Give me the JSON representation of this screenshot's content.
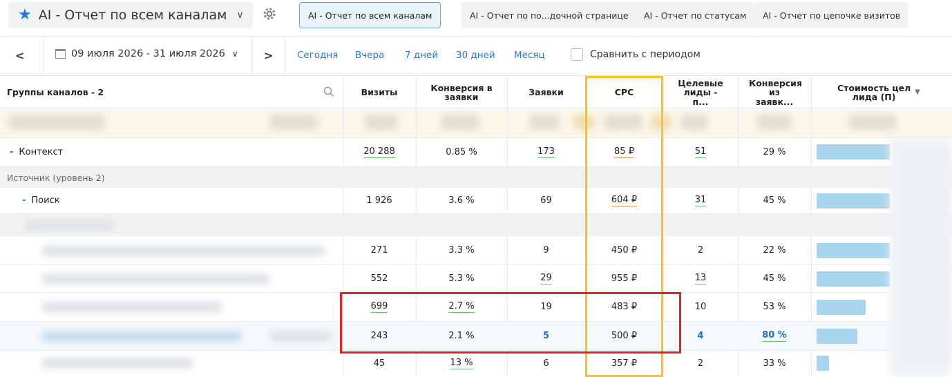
{
  "header": {
    "report_title": "AI - Отчет по всем каналам",
    "tabs": [
      {
        "label": "AI - Отчет по всем каналам",
        "active": true
      },
      {
        "label": "AI - Отчет по по...дочной странице",
        "active": false
      },
      {
        "label": "AI - Отчет по статусам",
        "active": false
      },
      {
        "label": "AI - Отчет по цепочке визитов",
        "active": false
      }
    ]
  },
  "datebar": {
    "range": "09 июля 2026 - 31 июля 2026",
    "quick": [
      "Сегодня",
      "Вчера",
      "7 дней",
      "30 дней",
      "Месяц"
    ],
    "compare_label": "Сравнить с периодом"
  },
  "table": {
    "columns": [
      "Группы каналов - 2",
      "Визиты",
      "Конверсия в заявки",
      "Заявки",
      "CPC",
      "Целевые лиды - п...",
      "Конверсия из заявк...",
      "Стоимость цел лида (П)"
    ],
    "rows": [
      {
        "label": "Контекст",
        "expand": "-",
        "visits": "20 288",
        "conv": "0.85 %",
        "leads": "173",
        "cpc": "85 ₽",
        "target": "51",
        "conv2": "29 %",
        "cost_share": 0.9
      },
      {
        "label": "Источник (уровень 2)",
        "group": true
      },
      {
        "label": "Поиск",
        "expand": "-",
        "visits": "1 926",
        "conv": "3.6 %",
        "leads": "69",
        "cpc": "604 ₽",
        "target": "31",
        "conv2": "45 %",
        "cost_share": 0.9
      },
      {
        "visits": "271",
        "conv": "3.3 %",
        "leads": "9",
        "cpc": "450 ₽",
        "target": "2",
        "conv2": "22 %",
        "cost_share": 0.9
      },
      {
        "visits": "552",
        "conv": "5.3 %",
        "leads": "29",
        "cpc": "955 ₽",
        "target": "13",
        "conv2": "45 %",
        "cost_share": 0.9
      },
      {
        "visits": "699",
        "conv": "2.7 %",
        "leads": "19",
        "cpc": "483 ₽",
        "target": "10",
        "conv2": "53 %",
        "cost_share": 0.6
      },
      {
        "visits": "243",
        "conv": "2.1 %",
        "leads": "5",
        "cpc": "500 ₽",
        "target": "4",
        "conv2": "80 %",
        "cost_share": 0.5
      },
      {
        "visits": "45",
        "conv": "13 %",
        "leads": "6",
        "cpc": "357 ₽",
        "target": "2",
        "conv2": "33 %",
        "cost_share": 0.15
      }
    ]
  },
  "colors": {
    "accent": "#1e7ae5",
    "highlight_yellow": "#f5c518",
    "highlight_red": "#e02424",
    "bar": "#a9d4f0"
  }
}
